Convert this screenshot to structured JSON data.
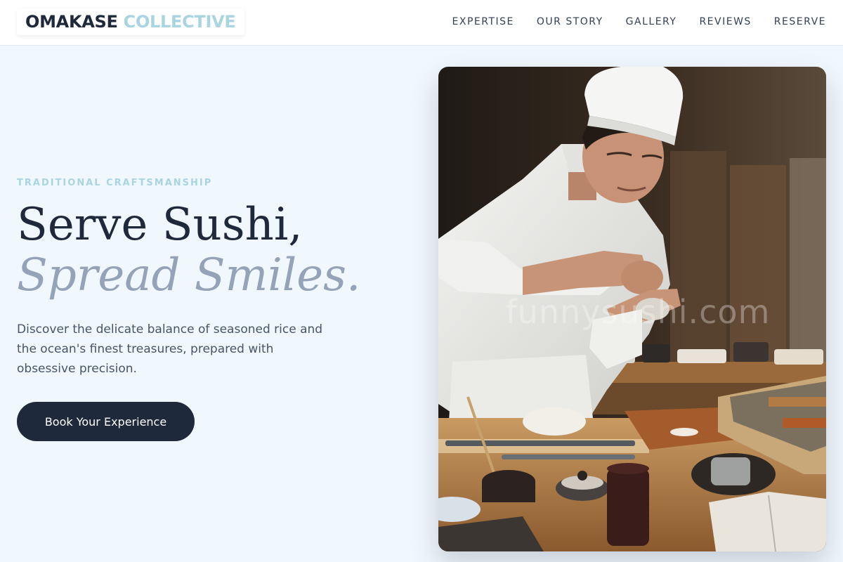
{
  "brand": {
    "name_primary": "OMAKASE",
    "name_accent": "COLLECTIVE"
  },
  "nav": {
    "items": [
      {
        "label": "EXPERTISE"
      },
      {
        "label": "OUR STORY"
      },
      {
        "label": "GALLERY"
      },
      {
        "label": "REVIEWS"
      },
      {
        "label": "RESERVE"
      }
    ]
  },
  "hero": {
    "eyebrow": "TRADITIONAL CRAFTSMANSHIP",
    "headline_line1": "Serve Sushi,",
    "headline_line2": "Spread Smiles.",
    "description": "Discover the delicate balance of seasoned rice and the ocean's finest treasures, prepared with obsessive precision.",
    "cta_label": "Book Your Experience",
    "image": {
      "subject": "sushi chef in white uniform and hat preparing sushi at a wooden counter",
      "watermark": "funnysushi.com"
    }
  },
  "colors": {
    "page_background": "#f0f7fd",
    "navy": "#1e293b",
    "accent_light_blue": "#a9d4e2",
    "muted_slate": "#94a3b8"
  }
}
